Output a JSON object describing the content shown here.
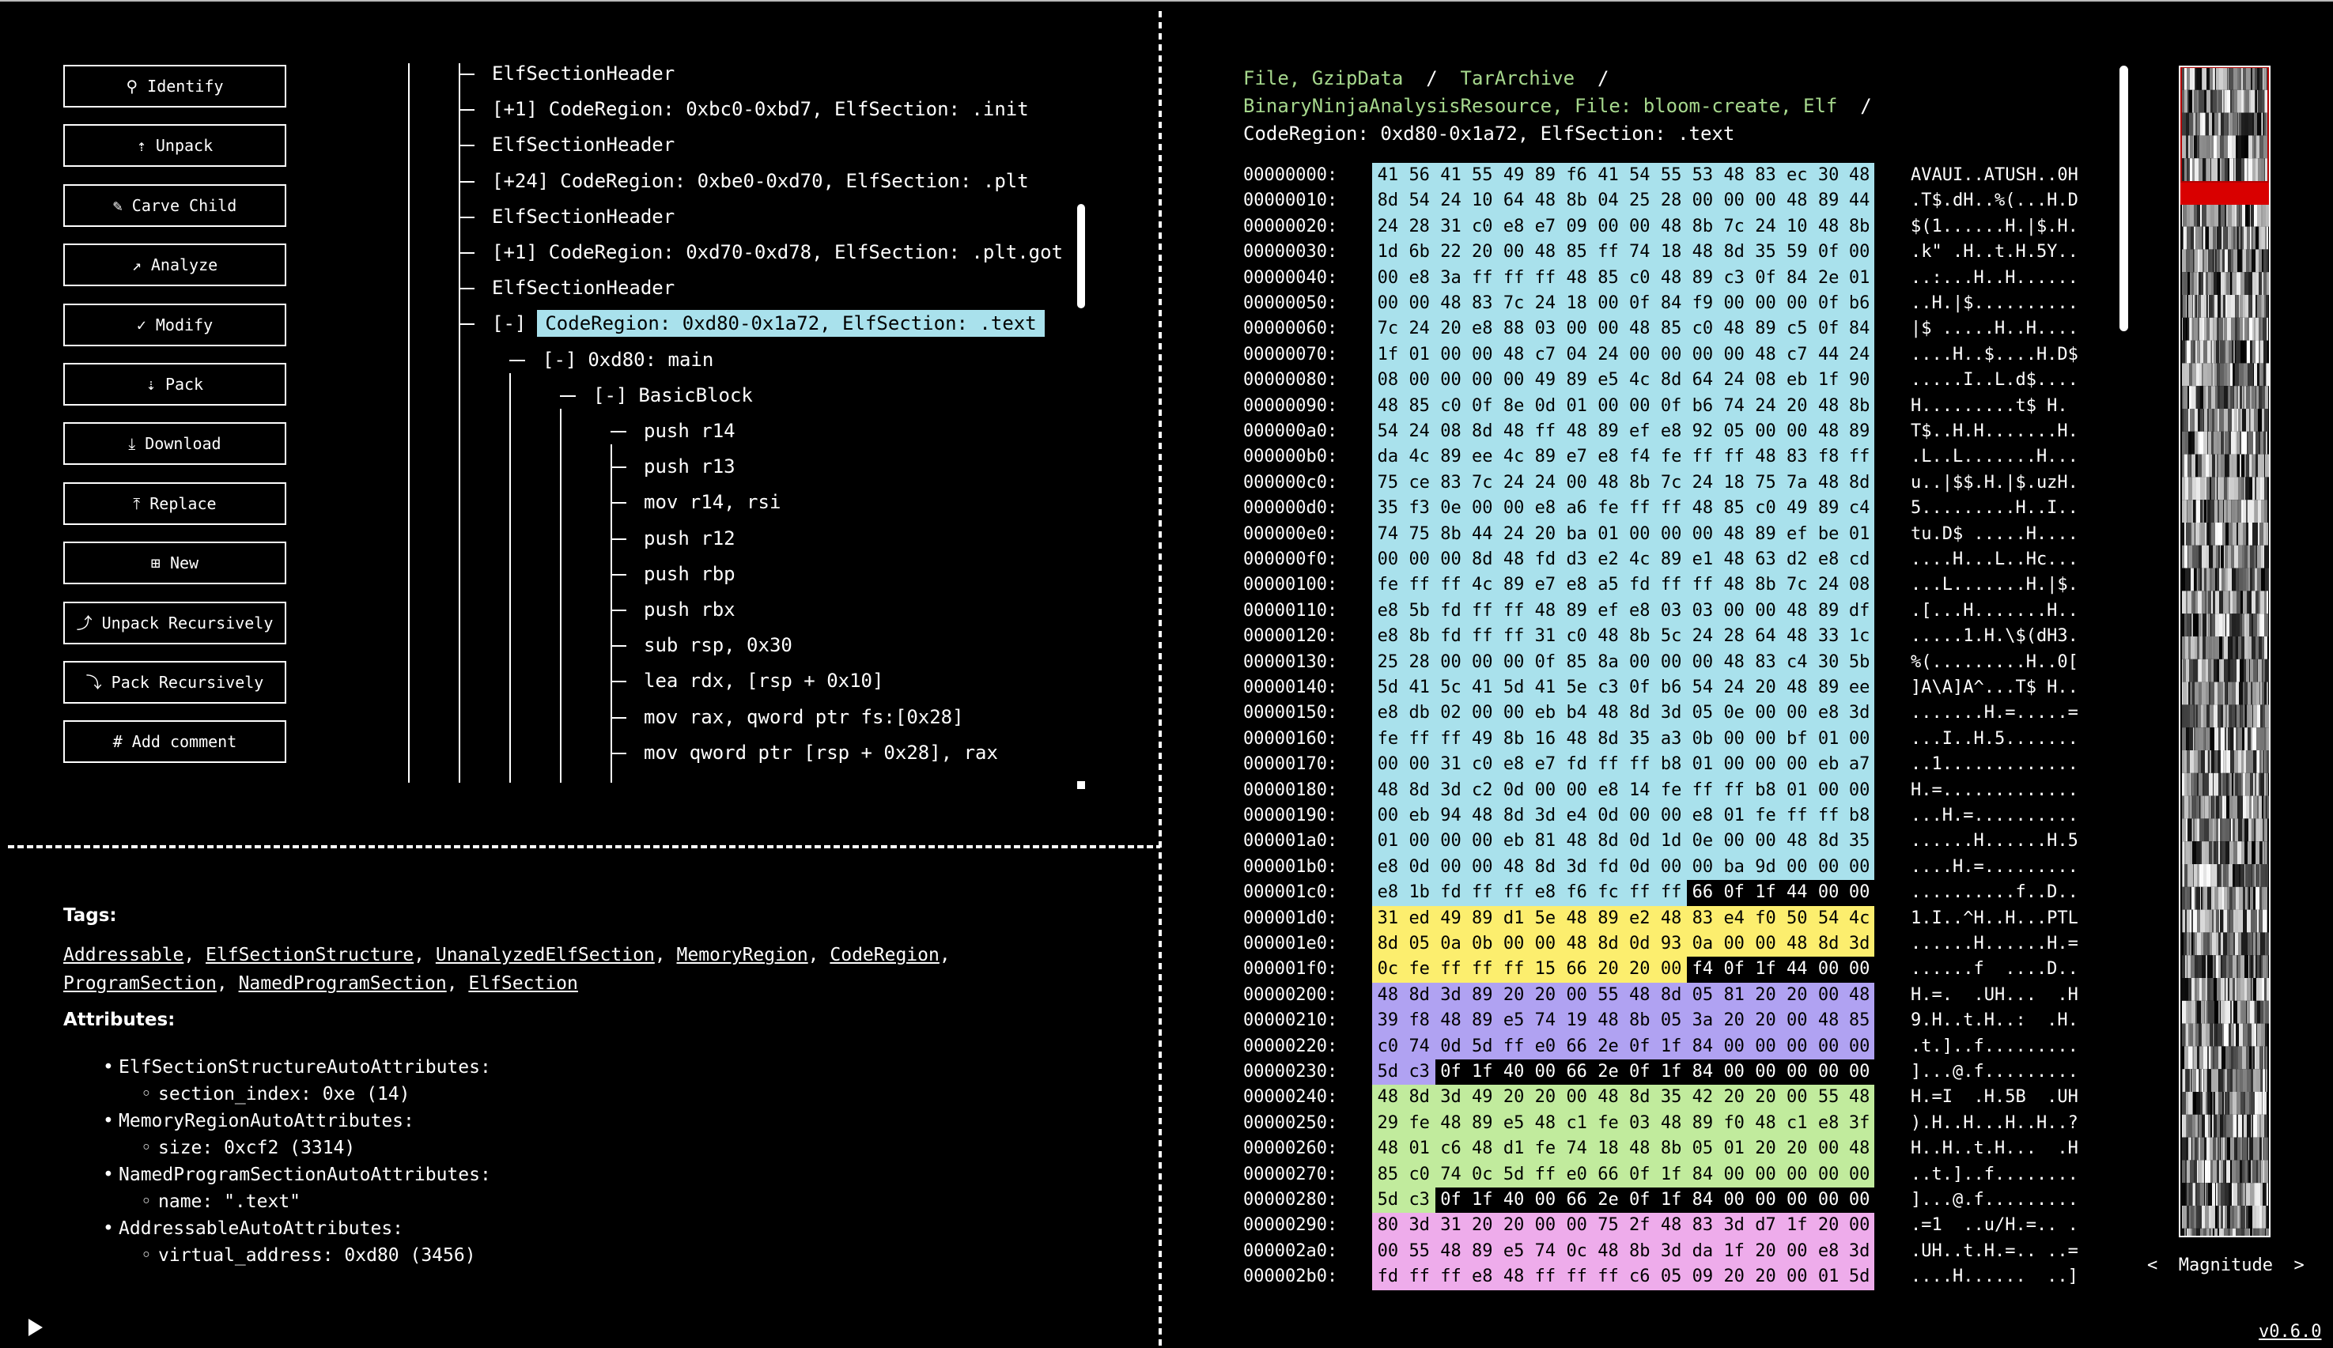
{
  "actions": [
    {
      "label": "Identify",
      "icon": "search-icon",
      "glyph": "⚲"
    },
    {
      "label": "Unpack",
      "icon": "unpack-icon",
      "glyph": "⇡"
    },
    {
      "label": "Carve Child",
      "icon": "knife-icon",
      "glyph": "✎"
    },
    {
      "label": "Analyze",
      "icon": "trend-icon",
      "glyph": "↗"
    },
    {
      "label": "Modify",
      "icon": "edit-box-icon",
      "glyph": "✓"
    },
    {
      "label": "Pack",
      "icon": "pack-icon",
      "glyph": "⇣"
    },
    {
      "label": "Download",
      "icon": "download-icon",
      "glyph": "⤓"
    },
    {
      "label": "Replace",
      "icon": "upload-icon",
      "glyph": "⤒"
    },
    {
      "label": "New",
      "icon": "new-file-icon",
      "glyph": "⊞"
    },
    {
      "label": "Unpack Recursively",
      "icon": "unpack-recursive-icon",
      "glyph": "⤴"
    },
    {
      "label": "Pack Recursively",
      "icon": "pack-recursive-icon",
      "glyph": "⤵"
    },
    {
      "label": "Add comment",
      "icon": "hash-icon",
      "glyph": "#"
    }
  ],
  "tree": {
    "rows": [
      {
        "depth": 0,
        "toggle": "",
        "text": "ElfSectionHeader",
        "selected": false
      },
      {
        "depth": 0,
        "toggle": "[+1]",
        "text": "CodeRegion: 0xbc0-0xbd7, ElfSection: .init",
        "selected": false
      },
      {
        "depth": 0,
        "toggle": "",
        "text": "ElfSectionHeader",
        "selected": false
      },
      {
        "depth": 0,
        "toggle": "[+24]",
        "text": "CodeRegion: 0xbe0-0xd70, ElfSection: .plt",
        "selected": false
      },
      {
        "depth": 0,
        "toggle": "",
        "text": "ElfSectionHeader",
        "selected": false
      },
      {
        "depth": 0,
        "toggle": "[+1]",
        "text": "CodeRegion: 0xd70-0xd78, ElfSection: .plt.got",
        "selected": false
      },
      {
        "depth": 0,
        "toggle": "",
        "text": "ElfSectionHeader",
        "selected": false
      },
      {
        "depth": 0,
        "toggle": "[-]",
        "text": "CodeRegion: 0xd80-0x1a72, ElfSection: .text",
        "selected": true
      },
      {
        "depth": 1,
        "toggle": "[-]",
        "text": "0xd80: main",
        "selected": false
      },
      {
        "depth": 2,
        "toggle": "[-]",
        "text": "BasicBlock",
        "selected": false
      },
      {
        "depth": 3,
        "toggle": "",
        "text": "push r14",
        "selected": false
      },
      {
        "depth": 3,
        "toggle": "",
        "text": "push r13",
        "selected": false
      },
      {
        "depth": 3,
        "toggle": "",
        "text": "mov r14, rsi",
        "selected": false
      },
      {
        "depth": 3,
        "toggle": "",
        "text": "push r12",
        "selected": false
      },
      {
        "depth": 3,
        "toggle": "",
        "text": "push rbp",
        "selected": false
      },
      {
        "depth": 3,
        "toggle": "",
        "text": "push rbx",
        "selected": false
      },
      {
        "depth": 3,
        "toggle": "",
        "text": "sub rsp, 0x30",
        "selected": false
      },
      {
        "depth": 3,
        "toggle": "",
        "text": "lea rdx, [rsp + 0x10]",
        "selected": false
      },
      {
        "depth": 3,
        "toggle": "",
        "text": "mov rax, qword ptr fs:[0x28]",
        "selected": false
      },
      {
        "depth": 3,
        "toggle": "",
        "text": "mov qword ptr [rsp + 0x28], rax",
        "selected": false
      }
    ]
  },
  "info": {
    "tags_label": "Tags:",
    "tags": [
      "Addressable",
      "ElfSectionStructure",
      "UnanalyzedElfSection",
      "MemoryRegion",
      "CodeRegion",
      "ProgramSection",
      "NamedProgramSection",
      "ElfSection"
    ],
    "attributes_label": "Attributes:",
    "attributes": [
      {
        "name": "ElfSectionStructureAutoAttributes:",
        "items": [
          "section_index: 0xe (14)"
        ]
      },
      {
        "name": "MemoryRegionAutoAttributes:",
        "items": [
          "size: 0xcf2 (3314)"
        ]
      },
      {
        "name": "NamedProgramSectionAutoAttributes:",
        "items": [
          "name: \".text\""
        ]
      },
      {
        "name": "AddressableAutoAttributes:",
        "items": [
          "virtual_address: 0xd80 (3456)"
        ]
      }
    ]
  },
  "breadcrumb": {
    "links": [
      "File, GzipData",
      "TarArchive",
      "BinaryNinjaAnalysisResource, File: bloom-create, Elf"
    ],
    "separator": "/",
    "current": "CodeRegion: 0xd80-0x1a72, ElfSection: .text"
  },
  "hex": {
    "colors": {
      "cyan": "#a9e1ec",
      "yellow": "#fcee6e",
      "purple": "#b0a2f2",
      "green": "#c1eb9d",
      "pink": "#eeaceb",
      "none": "#000000"
    },
    "rows": [
      {
        "offset": "00000000:",
        "bytes": "41 56 41 55 49 89 f6 41 54 55 53 48 83 ec 30 48",
        "ascii": "AVAUI..ATUSH..0H",
        "colors": "cccccccccccccccc"
      },
      {
        "offset": "00000010:",
        "bytes": "8d 54 24 10 64 48 8b 04 25 28 00 00 00 48 89 44",
        "ascii": ".T$.dH..%(...H.D",
        "colors": "cccccccccccccccc"
      },
      {
        "offset": "00000020:",
        "bytes": "24 28 31 c0 e8 e7 09 00 00 48 8b 7c 24 10 48 8b",
        "ascii": "$(1......H.|$.H.",
        "colors": "cccccccccccccccc"
      },
      {
        "offset": "00000030:",
        "bytes": "1d 6b 22 20 00 48 85 ff 74 18 48 8d 35 59 0f 00",
        "ascii": ".k\" .H..t.H.5Y..",
        "colors": "cccccccccccccccc"
      },
      {
        "offset": "00000040:",
        "bytes": "00 e8 3a ff ff ff 48 85 c0 48 89 c3 0f 84 2e 01",
        "ascii": "..:...H..H......",
        "colors": "cccccccccccccccc"
      },
      {
        "offset": "00000050:",
        "bytes": "00 00 48 83 7c 24 18 00 0f 84 f9 00 00 00 0f b6",
        "ascii": "..H.|$..........",
        "colors": "cccccccccccccccc"
      },
      {
        "offset": "00000060:",
        "bytes": "7c 24 20 e8 88 03 00 00 48 85 c0 48 89 c5 0f 84",
        "ascii": "|$ .....H..H....",
        "colors": "cccccccccccccccc"
      },
      {
        "offset": "00000070:",
        "bytes": "1f 01 00 00 48 c7 04 24 00 00 00 00 48 c7 44 24",
        "ascii": "....H..$....H.D$",
        "colors": "cccccccccccccccc"
      },
      {
        "offset": "00000080:",
        "bytes": "08 00 00 00 00 49 89 e5 4c 8d 64 24 08 eb 1f 90",
        "ascii": ".....I..L.d$....",
        "colors": "cccccccccccccccc"
      },
      {
        "offset": "00000090:",
        "bytes": "48 85 c0 0f 8e 0d 01 00 00 0f b6 74 24 20 48 8b",
        "ascii": "H.........t$ H.",
        "colors": "cccccccccccccccc"
      },
      {
        "offset": "000000a0:",
        "bytes": "54 24 08 8d 48 ff 48 89 ef e8 92 05 00 00 48 89",
        "ascii": "T$..H.H.......H.",
        "colors": "cccccccccccccccc"
      },
      {
        "offset": "000000b0:",
        "bytes": "da 4c 89 ee 4c 89 e7 e8 f4 fe ff ff 48 83 f8 ff",
        "ascii": ".L..L.......H...",
        "colors": "cccccccccccccccc"
      },
      {
        "offset": "000000c0:",
        "bytes": "75 ce 83 7c 24 24 00 48 8b 7c 24 18 75 7a 48 8d",
        "ascii": "u..|$$.H.|$.uzH.",
        "colors": "cccccccccccccccc"
      },
      {
        "offset": "000000d0:",
        "bytes": "35 f3 0e 00 00 e8 a6 fe ff ff 48 85 c0 49 89 c4",
        "ascii": "5.........H..I..",
        "colors": "cccccccccccccccc"
      },
      {
        "offset": "000000e0:",
        "bytes": "74 75 8b 44 24 20 ba 01 00 00 00 48 89 ef be 01",
        "ascii": "tu.D$ .....H....",
        "colors": "cccccccccccccccc"
      },
      {
        "offset": "000000f0:",
        "bytes": "00 00 00 8d 48 fd d3 e2 4c 89 e1 48 63 d2 e8 cd",
        "ascii": "....H...L..Hc...",
        "colors": "cccccccccccccccc"
      },
      {
        "offset": "00000100:",
        "bytes": "fe ff ff 4c 89 e7 e8 a5 fd ff ff 48 8b 7c 24 08",
        "ascii": "...L.......H.|$.",
        "colors": "cccccccccccccccc"
      },
      {
        "offset": "00000110:",
        "bytes": "e8 5b fd ff ff 48 89 ef e8 03 03 00 00 48 89 df",
        "ascii": ".[...H.......H..",
        "colors": "cccccccccccccccc"
      },
      {
        "offset": "00000120:",
        "bytes": "e8 8b fd ff ff 31 c0 48 8b 5c 24 28 64 48 33 1c",
        "ascii": ".....1.H.\\$(dH3.",
        "colors": "cccccccccccccccc"
      },
      {
        "offset": "00000130:",
        "bytes": "25 28 00 00 00 0f 85 8a 00 00 00 48 83 c4 30 5b",
        "ascii": "%(.........H..0[",
        "colors": "cccccccccccccccc"
      },
      {
        "offset": "00000140:",
        "bytes": "5d 41 5c 41 5d 41 5e c3 0f b6 54 24 20 48 89 ee",
        "ascii": "]A\\A]A^...T$ H..",
        "colors": "cccccccccccccccc"
      },
      {
        "offset": "00000150:",
        "bytes": "e8 db 02 00 00 eb b4 48 8d 3d 05 0e 00 00 e8 3d",
        "ascii": ".......H.=.....=",
        "colors": "cccccccccccccccc"
      },
      {
        "offset": "00000160:",
        "bytes": "fe ff ff 49 8b 16 48 8d 35 a3 0b 00 00 bf 01 00",
        "ascii": "...I..H.5.......",
        "colors": "cccccccccccccccc"
      },
      {
        "offset": "00000170:",
        "bytes": "00 00 31 c0 e8 e7 fd ff ff b8 01 00 00 00 eb a7",
        "ascii": "..1.............",
        "colors": "cccccccccccccccc"
      },
      {
        "offset": "00000180:",
        "bytes": "48 8d 3d c2 0d 00 00 e8 14 fe ff ff b8 01 00 00",
        "ascii": "H.=.............",
        "colors": "cccccccccccccccc"
      },
      {
        "offset": "00000190:",
        "bytes": "00 eb 94 48 8d 3d e4 0d 00 00 e8 01 fe ff ff b8",
        "ascii": "...H.=..........",
        "colors": "cccccccccccccccc"
      },
      {
        "offset": "000001a0:",
        "bytes": "01 00 00 00 eb 81 48 8d 0d 1d 0e 00 00 48 8d 35",
        "ascii": "......H......H.5",
        "colors": "cccccccccccccccc"
      },
      {
        "offset": "000001b0:",
        "bytes": "e8 0d 00 00 48 8d 3d fd 0d 00 00 ba 9d 00 00 00",
        "ascii": "....H.=.........",
        "colors": "cccccccccccccccc"
      },
      {
        "offset": "000001c0:",
        "bytes": "e8 1b fd ff ff e8 f6 fc ff ff 66 0f 1f 44 00 00",
        "ascii": "..........f..D..",
        "colors": "cccccccccc------"
      },
      {
        "offset": "000001d0:",
        "bytes": "31 ed 49 89 d1 5e 48 89 e2 48 83 e4 f0 50 54 4c",
        "ascii": "1.I..^H..H...PTL",
        "colors": "yyyyyyyyyyyyyyyy"
      },
      {
        "offset": "000001e0:",
        "bytes": "8d 05 0a 0b 00 00 48 8d 0d 93 0a 00 00 48 8d 3d",
        "ascii": "......H......H.=",
        "colors": "yyyyyyyyyyyyyyyy"
      },
      {
        "offset": "000001f0:",
        "bytes": "0c fe ff ff ff 15 66 20 20 00 f4 0f 1f 44 00 00",
        "ascii": "......f  ....D..",
        "colors": "yyyyyyyyyy------"
      },
      {
        "offset": "00000200:",
        "bytes": "48 8d 3d 89 20 20 00 55 48 8d 05 81 20 20 00 48",
        "ascii": "H.=.  .UH...  .H",
        "colors": "pppppppppppppppp"
      },
      {
        "offset": "00000210:",
        "bytes": "39 f8 48 89 e5 74 19 48 8b 05 3a 20 20 00 48 85",
        "ascii": "9.H..t.H..:  .H.",
        "colors": "pppppppppppppppp"
      },
      {
        "offset": "00000220:",
        "bytes": "c0 74 0d 5d ff e0 66 2e 0f 1f 84 00 00 00 00 00",
        "ascii": ".t.]..f.........",
        "colors": "pppppppppppppppp"
      },
      {
        "offset": "00000230:",
        "bytes": "5d c3 0f 1f 40 00 66 2e 0f 1f 84 00 00 00 00 00",
        "ascii": "]...@.f.........",
        "colors": "pp--------------"
      },
      {
        "offset": "00000240:",
        "bytes": "48 8d 3d 49 20 20 00 48 8d 35 42 20 20 00 55 48",
        "ascii": "H.=I  .H.5B  .UH",
        "colors": "gggggggggggggggg"
      },
      {
        "offset": "00000250:",
        "bytes": "29 fe 48 89 e5 48 c1 fe 03 48 89 f0 48 c1 e8 3f",
        "ascii": ").H..H...H..H..?",
        "colors": "gggggggggggggggg"
      },
      {
        "offset": "00000260:",
        "bytes": "48 01 c6 48 d1 fe 74 18 48 8b 05 01 20 20 00 48",
        "ascii": "H..H..t.H...  .H",
        "colors": "gggggggggggggggg"
      },
      {
        "offset": "00000270:",
        "bytes": "85 c0 74 0c 5d ff e0 66 0f 1f 84 00 00 00 00 00",
        "ascii": "..t.]..f........",
        "colors": "gggggggggggggggg"
      },
      {
        "offset": "00000280:",
        "bytes": "5d c3 0f 1f 40 00 66 2e 0f 1f 84 00 00 00 00 00",
        "ascii": "]...@.f.........",
        "colors": "gg--------------"
      },
      {
        "offset": "00000290:",
        "bytes": "80 3d 31 20 20 00 00 75 2f 48 83 3d d7 1f 20 00",
        "ascii": ".=1  ..u/H.=.. .",
        "colors": "mmmmmmmmmmmmmmmm"
      },
      {
        "offset": "000002a0:",
        "bytes": "00 55 48 89 e5 74 0c 48 8b 3d da 1f 20 00 e8 3d",
        "ascii": ".UH..t.H.=.. ..=",
        "colors": "mmmmmmmmmmmmmmmm"
      },
      {
        "offset": "000002b0:",
        "bytes": "fd ff ff e8 48 ff ff ff c6 05 09 20 20 00 01 5d",
        "ascii": "....H......  ..]",
        "colors": "mmmmmmmmmmmmmmmm"
      }
    ]
  },
  "minimap": {
    "mode_label": "Magnitude",
    "prev": "<",
    "next": ">",
    "highlight_color": "#d90000"
  },
  "version": "v0.6.0"
}
